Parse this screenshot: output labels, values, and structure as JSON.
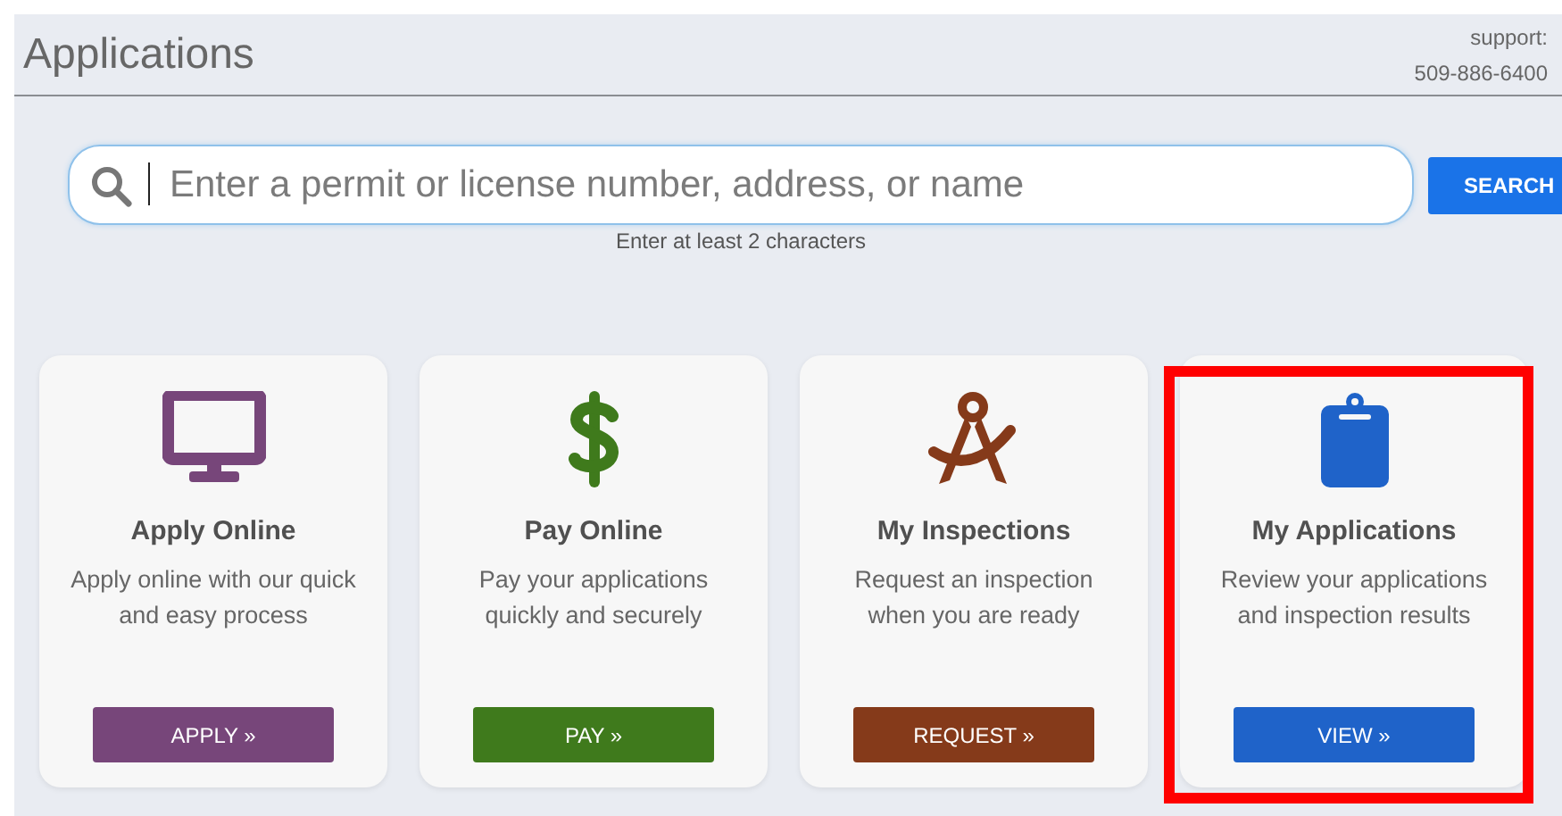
{
  "header": {
    "title": "Applications",
    "support_label": "support:",
    "support_phone": "509-886-6400"
  },
  "search": {
    "placeholder": "Enter a permit or license number, address, or name",
    "button": "SEARCH",
    "hint": "Enter at least 2 characters"
  },
  "cards": [
    {
      "kind": "apply",
      "title": "Apply Online",
      "description": "Apply online with our quick and easy process",
      "button": "APPLY »",
      "color": "#77467a",
      "highlighted": false
    },
    {
      "kind": "pay",
      "title": "Pay Online",
      "description": "Pay your applications quickly and securely",
      "button": "PAY »",
      "color": "#3f7a1c",
      "highlighted": false
    },
    {
      "kind": "inspections",
      "title": "My Inspections",
      "description": "Request an inspection when you are ready",
      "button": "REQUEST »",
      "color": "#853a1a",
      "highlighted": false
    },
    {
      "kind": "applications",
      "title": "My Applications",
      "description": "Review your applications and inspection results",
      "button": "VIEW »",
      "color": "#1f63c9",
      "highlighted": true
    }
  ]
}
